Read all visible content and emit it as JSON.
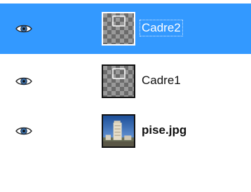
{
  "colors": {
    "selection": "#3399ff",
    "background": "#ffffff",
    "text": "#111111",
    "selected_text": "#ffffff"
  },
  "layers": [
    {
      "name": "Cadre2",
      "selected": true,
      "visible": true,
      "thumbnail": "transparent-frame",
      "visibility_icon": "eye-icon"
    },
    {
      "name": "Cadre1",
      "selected": false,
      "visible": true,
      "thumbnail": "transparent-frame",
      "visibility_icon": "eye-icon"
    },
    {
      "name": "pise.jpg",
      "selected": false,
      "visible": true,
      "thumbnail": "tower-photo",
      "visibility_icon": "eye-icon"
    }
  ]
}
